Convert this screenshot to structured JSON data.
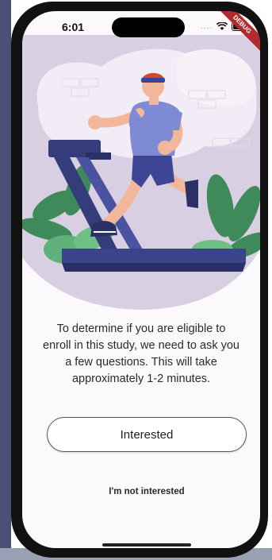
{
  "status_bar": {
    "time": "6:01",
    "signal_dots": "....",
    "debug_label": "DEBUG"
  },
  "screen": {
    "message": "To determine if you are eligible to enroll in this study, we need to ask you a few questions. This will take approximately 1-2 minutes.",
    "interested_label": "Interested",
    "not_interested_label": "I'm not interested"
  },
  "colors": {
    "accent_treadmill": "#343c7a",
    "leaf_green": "#3f8a5a",
    "blob_purple": "#d9cfe3",
    "shirt": "#7f8ad4",
    "headband": "#d3482d",
    "debug_red": "#b4292b"
  },
  "icons": {
    "wifi": "wifi-icon",
    "battery": "battery-icon"
  }
}
